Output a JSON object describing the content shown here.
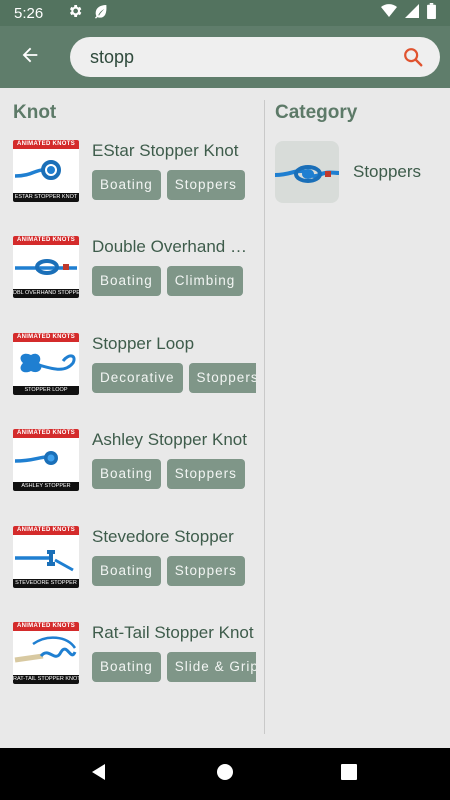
{
  "status_bar": {
    "time": "5:26",
    "icons": [
      "settings-gear-icon",
      "leaf-icon",
      "wifi-icon",
      "signal-icon",
      "battery-icon"
    ]
  },
  "app_bar": {
    "back_icon": "arrow-back-icon",
    "search": {
      "value": "stopp",
      "icon": "search-icon"
    }
  },
  "knots": {
    "title": "Knot",
    "items": [
      {
        "name": "EStar Stopper Knot",
        "tags": [
          "Boating",
          "Stoppers"
        ],
        "thumb_caption": "ESTAR STOPPER KNOT"
      },
      {
        "name": "Double Overhand Stopper",
        "tags": [
          "Boating",
          "Climbing"
        ],
        "thumb_caption": "DBL OVERHAND STOPPER"
      },
      {
        "name": "Stopper Loop",
        "tags": [
          "Decorative",
          "Stoppers"
        ],
        "thumb_caption": "STOPPER LOOP"
      },
      {
        "name": "Ashley Stopper Knot",
        "tags": [
          "Boating",
          "Stoppers"
        ],
        "thumb_caption": "ASHLEY STOPPER"
      },
      {
        "name": "Stevedore Stopper",
        "tags": [
          "Boating",
          "Stoppers"
        ],
        "thumb_caption": "STEVEDORE STOPPER"
      },
      {
        "name": "Rat-Tail Stopper Knot",
        "tags": [
          "Boating",
          "Slide & Grip"
        ],
        "thumb_caption": "RAT-TAIL STOPPER KNOT"
      }
    ],
    "thumb_banner": "ANIMATED KNOTS"
  },
  "categories": {
    "title": "Category",
    "items": [
      {
        "label": "Stoppers"
      }
    ]
  },
  "colors": {
    "status_bar": "#53735f",
    "app_bar": "#5f7d6b",
    "tag_bg": "#7f9688",
    "rope_blue": "#1f7fd1",
    "banner_red": "#d42b2b"
  },
  "nav_bar": {
    "buttons": [
      "back-triangle-icon",
      "home-circle-icon",
      "recents-square-icon"
    ]
  }
}
